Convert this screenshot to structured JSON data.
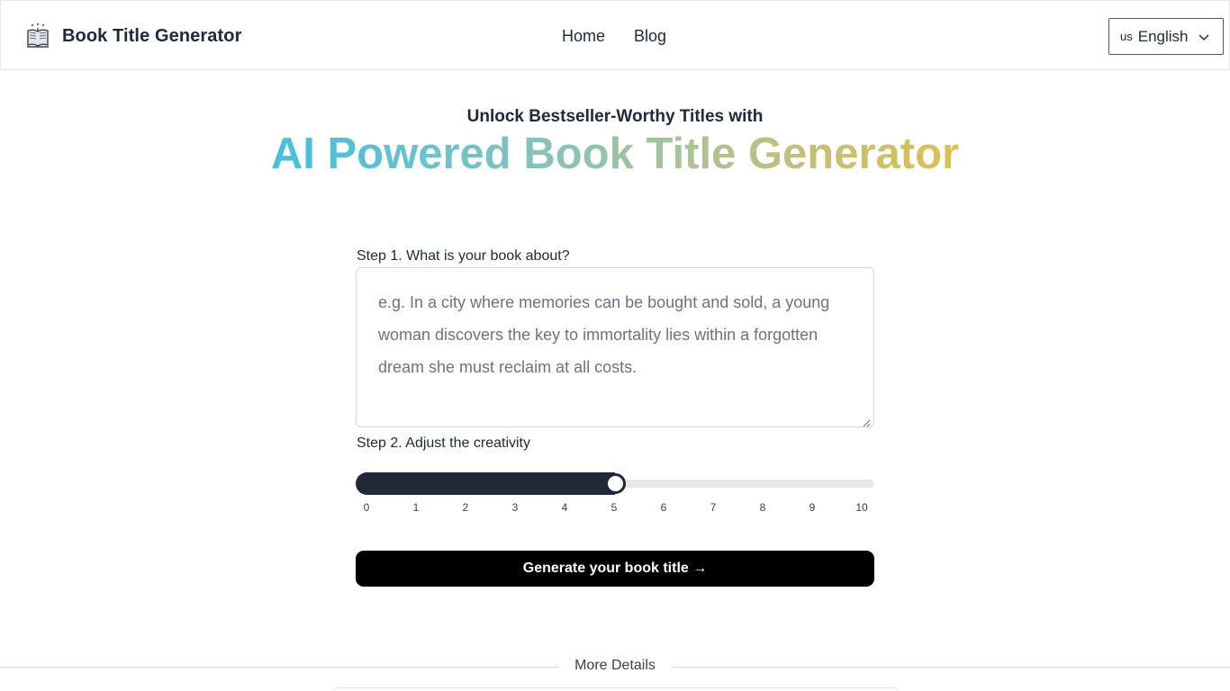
{
  "header": {
    "brand_name": "Book Title Generator",
    "logo_icon": "open-book-icon",
    "nav": [
      {
        "label": "Home"
      },
      {
        "label": "Blog"
      }
    ],
    "language": {
      "flag": "us",
      "label": "English",
      "chevron_icon": "chevron-down-icon"
    }
  },
  "hero": {
    "subtitle": "Unlock Bestseller-Worthy Titles with",
    "title": "AI Powered Book Title Generator",
    "gradient_colors": [
      "#45bfe0",
      "#7ec3c0",
      "#b2c190",
      "#dcc052"
    ]
  },
  "form": {
    "step1_label": "Step 1. What is your book about?",
    "description": {
      "value": "",
      "placeholder": "e.g. In a city where memories can be bought and sold, a young woman discovers the key to immortality lies within a forgotten dream she must reclaim at all costs."
    },
    "step2_label": "Step 2. Adjust the creativity",
    "creativity": {
      "min": 0,
      "max": 10,
      "value": 5,
      "ticks": [
        "0",
        "1",
        "2",
        "3",
        "4",
        "5",
        "6",
        "7",
        "8",
        "9",
        "10"
      ]
    },
    "generate_label": "Generate your book title →"
  },
  "more_details_label": "More Details",
  "colors": {
    "text": "#1f2937",
    "slider_fill": "#1f2937",
    "button_bg": "#000000"
  }
}
